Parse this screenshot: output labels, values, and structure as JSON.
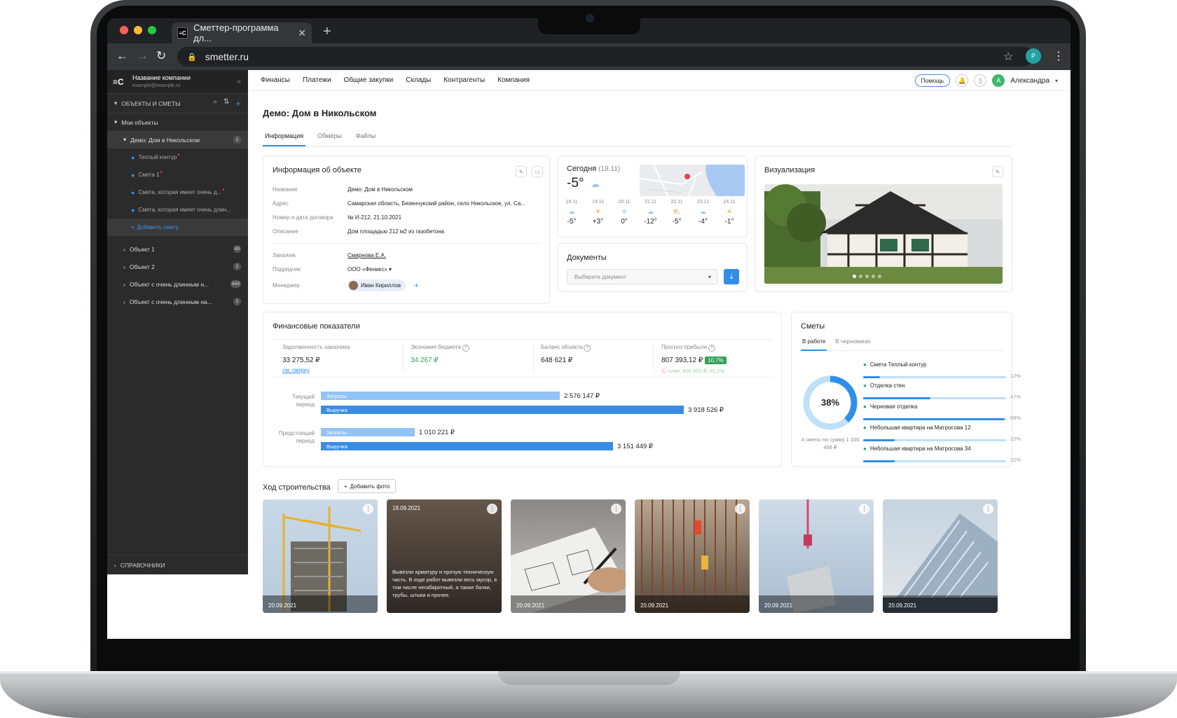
{
  "browser": {
    "tab_title": "Сметтер-программа дл...",
    "url": "smetter.ru",
    "profile_initial": "Р"
  },
  "sidebar": {
    "company_name": "Название компании",
    "company_email": "example@example.ru",
    "section_title": "ОБЪЕКТЫ И СМЕТЫ",
    "my_objects": "Мои объекты",
    "active_object": "Демо: Дом в Никольском",
    "active_badge": "1",
    "subitems": [
      "Теплый контур",
      "Смета 1",
      "Смета, которая имеет очень д...",
      "Смета, которая имеет очень длин..."
    ],
    "add_smeta": "Добавить смету",
    "objects": [
      {
        "label": "Объект 1",
        "badge": "43"
      },
      {
        "label": "Объект 2",
        "badge": "1"
      },
      {
        "label": "Объект с очень длинным н...",
        "badge": "643"
      },
      {
        "label": "Объект с очень длинным на...",
        "badge": "1"
      }
    ],
    "bottom_section": "СПРАВОЧНИКИ"
  },
  "topnav": {
    "items": [
      "Финансы",
      "Платежи",
      "Общие закупки",
      "Склады",
      "Контрагенты",
      "Компания"
    ],
    "help": "Помощь",
    "user_initial": "А",
    "user_name": "Александра"
  },
  "page": {
    "title": "Демо: Дом в Никольском",
    "tabs": [
      "Информация",
      "Обмеры",
      "Файлы"
    ]
  },
  "info": {
    "title": "Информация об объекте",
    "rows": [
      {
        "k": "Название",
        "v": "Демо: Дом в Никольском"
      },
      {
        "k": "Адрес",
        "v": "Самарская область, Безенчукский район, село Никольское, ул. Са..."
      },
      {
        "k": "Номер и дата договора",
        "v": "№ И-212, 21.10.2021"
      },
      {
        "k": "Описание",
        "v": "Дом площадью 212 м2 из газобетона"
      }
    ],
    "customer_k": "Заказчик",
    "customer_v": "Смирнова Е.А.",
    "contractor_k": "Подрядчик",
    "contractor_v": "ООО «Феникс»",
    "manager_k": "Менеджер",
    "manager_v": "Иван Кириллов"
  },
  "weather": {
    "title": "Сегодня",
    "date": "(18.11)",
    "temp": "-5°",
    "days": [
      {
        "d": "18.11",
        "t": "-5°",
        "icon": "cloud-snow-icon"
      },
      {
        "d": "19.11",
        "t": "+3°",
        "icon": "sun-icon"
      },
      {
        "d": "20.11",
        "t": "0°",
        "icon": "snow-icon"
      },
      {
        "d": "21.11",
        "t": "-12°",
        "icon": "cloud-snow-icon"
      },
      {
        "d": "22.11",
        "t": "-5°",
        "icon": "sun-cloud-icon"
      },
      {
        "d": "23.11",
        "t": "-4°",
        "icon": "cloud-snow-icon"
      },
      {
        "d": "24.11",
        "t": "-1°",
        "icon": "sun-icon"
      }
    ]
  },
  "documents": {
    "title": "Документы",
    "placeholder": "Выберите документ"
  },
  "visual": {
    "title": "Визуализация"
  },
  "finance": {
    "title": "Финансовые показатели",
    "metrics": [
      {
        "label": "Задолженность заказчика",
        "value": "33 275,52 ₽",
        "link": "см. сверку"
      },
      {
        "label": "Экономия бюджета",
        "value": "34 267 ₽"
      },
      {
        "label": "Баланс объекта",
        "value": "648 621 ₽"
      },
      {
        "label": "Прогноз прибыли",
        "value": "807 393,12 ₽",
        "pct": "10,7%",
        "plan": "план: 800 455 ₽; 30,1%"
      }
    ],
    "periods": [
      {
        "label": "Текущий период",
        "costs_label": "Затраты",
        "costs": "2 576 147 ₽",
        "revenue_label": "Выручка",
        "revenue": "3 918 526 ₽"
      },
      {
        "label": "Предстоящий период",
        "costs_label": "Затраты",
        "costs": "1 010 221 ₽",
        "revenue_label": "Выручка",
        "revenue": "3 151 449 ₽"
      }
    ]
  },
  "chart_data": {
    "type": "bar",
    "categories": [
      "Текущий период",
      "Предстоящий период"
    ],
    "series": [
      {
        "name": "Затраты",
        "values": [
          2576147,
          1010221
        ]
      },
      {
        "name": "Выручка",
        "values": [
          3918526,
          3151449
        ]
      }
    ]
  },
  "smety": {
    "title": "Сметы",
    "tabs": [
      "В работе",
      "В черновиках"
    ],
    "donut_pct": "38%",
    "donut_value": 0.38,
    "summary": "4 сметы на сумму 1 100 456 ₽",
    "items": [
      {
        "label": "Смета Теплый контур",
        "pct": "12%",
        "value": 0.12
      },
      {
        "label": "Отделка стен",
        "pct": "47%",
        "value": 0.47
      },
      {
        "label": "Черновая отделка",
        "pct": "99%",
        "value": 0.99
      },
      {
        "label": "Небольшая квартира на Матросова 12",
        "pct": "22%",
        "value": 0.22
      },
      {
        "label": "Небольшая квартира на Матросова 34",
        "pct": "22%",
        "value": 0.22
      }
    ]
  },
  "progress": {
    "title": "Ход строительства",
    "add_photo": "Добавить фото",
    "photos": [
      {
        "date": "20.09.2021"
      },
      {
        "date": "19.09.2021",
        "caption": "Вывезли арматуру и прочую техническую часть. В ходе работ вывезли весь мусор, в том числе негабаритный, а также балки, трубы, штыки и прочее."
      },
      {
        "date": "20.09.2021"
      },
      {
        "date": "20.09.2021"
      },
      {
        "date": "20.09.2021"
      },
      {
        "date": "20.09.2021"
      }
    ]
  }
}
